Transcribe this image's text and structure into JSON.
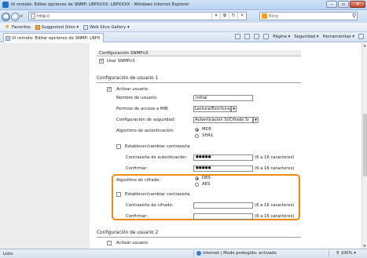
{
  "window": {
    "title": "IU remoto: Editar opciones de SNMP: LBPXXXX: LBPXXXX - Windows Internet Explorer"
  },
  "navigation": {
    "address": "http://",
    "search_placeholder": "Bing"
  },
  "favorites_bar": {
    "favorites_label": "Favoritos",
    "items": [
      "Suggested Sites ▾",
      "Web Slice Gallery ▾"
    ]
  },
  "tab": {
    "label": "IU remoto: Editar opciones de SNMP: LBPXXXX: L"
  },
  "command_bar": {
    "items": [
      "Página ▾",
      "Seguridad ▾",
      "Herramientas ▾"
    ]
  },
  "snmpv3": {
    "header": "Configuración SNMPv3",
    "use_label": "Usar SNMPv3",
    "use_checked": true
  },
  "user1": {
    "title": "Configuración de usuario 1",
    "enable_label": "Activar usuario",
    "enable_checked": true,
    "username_label": "Nombre de usuario:",
    "username_value": "initial",
    "mib_label": "Permiso de acceso a MIB",
    "mib_value": "Lectura/Escritura",
    "security_label": "Configuración de seguridad:",
    "security_value": "Autenticación Sí/Cifrado Sí",
    "auth_algo_label": "Algoritmo de autenticación:",
    "auth_algo_options": [
      "MD5",
      "SHA1"
    ],
    "auth_algo_selected": "MD5",
    "set_auth_pw_label": "Establecer/cambiar contraseña",
    "auth_pw_label": "Contraseña de autenticación:",
    "auth_pw_value": "●●●●●",
    "auth_pw_hint": "(6 a 16 caracteres)",
    "confirm_label": "Confirmar:",
    "confirm_value": "●●●●●",
    "confirm_hint": "(6 a 16 caracteres)",
    "enc_algo_label": "Algoritmo de cifrado:",
    "enc_algo_options": [
      "DES",
      "AES"
    ],
    "enc_algo_selected": "DES",
    "set_enc_pw_label": "Establecer/cambiar contraseña",
    "enc_pw_label": "Contraseña de cifrado:",
    "enc_pw_value": "",
    "enc_pw_hint": "(6 a 16 caracteres)",
    "enc_confirm_label": "Confirmar:",
    "enc_confirm_value": "",
    "enc_confirm_hint": "(6 a 16 caracteres)"
  },
  "user2": {
    "title": "Configuración de usuario 2",
    "enable_label": "Activar usuario",
    "enable_checked": false
  },
  "status_bar": {
    "left": "Listo",
    "zone": "Internet | Modo protegido: activado",
    "zoom": "100%"
  },
  "colors": {
    "highlight": "#ec8b12"
  }
}
